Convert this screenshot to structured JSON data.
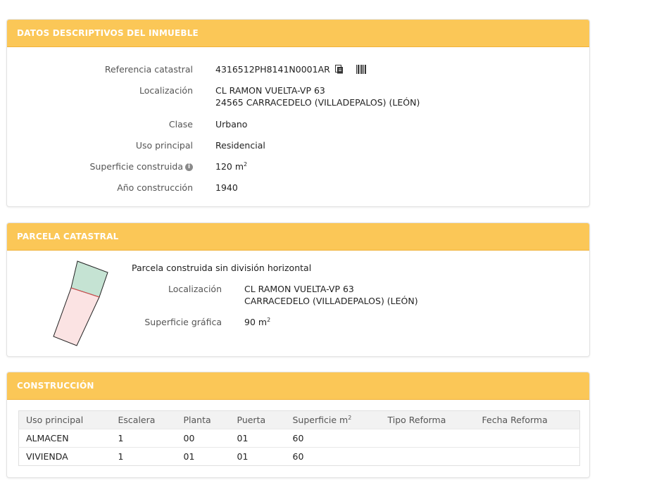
{
  "inmueble": {
    "title": "DATOS DESCRIPTIVOS DEL INMUEBLE",
    "fields": {
      "ref_label": "Referencia catastral",
      "ref_value": "4316512PH8141N0001AR",
      "loc_label": "Localización",
      "loc_line1": "CL RAMON VUELTA-VP 63",
      "loc_line2": "24565 CARRACEDELO (VILLADEPALOS) (LEÓN)",
      "clase_label": "Clase",
      "clase_value": "Urbano",
      "uso_label": "Uso principal",
      "uso_value": "Residencial",
      "sup_label": "Superficie construida",
      "sup_value": "120 m",
      "sup_unit_exp": "2",
      "anio_label": "Año construcción",
      "anio_value": "1940"
    },
    "info_icon": "i"
  },
  "parcela": {
    "title": "PARCELA CATASTRAL",
    "description": "Parcela construida sin división horizontal",
    "loc_label": "Localización",
    "loc_line1": "CL RAMON VUELTA-VP 63",
    "loc_line2": "CARRACEDELO (VILLADEPALOS) (LEÓN)",
    "sup_label": "Superficie gráfica",
    "sup_value": "90 m",
    "sup_unit_exp": "2"
  },
  "construccion": {
    "title": "CONSTRUCCIÓN",
    "headers": [
      "Uso principal",
      "Escalera",
      "Planta",
      "Puerta",
      "Superficie m",
      "Tipo Reforma",
      "Fecha Reforma"
    ],
    "sup_header_exp": "2",
    "rows": [
      [
        "ALMACEN",
        "1",
        "00",
        "01",
        "60",
        "",
        ""
      ],
      [
        "VIVIENDA",
        "1",
        "01",
        "01",
        "60",
        "",
        ""
      ]
    ]
  },
  "colors": {
    "header_bg": "#fbc757",
    "parcel_green": "#c5e3d3",
    "parcel_pink": "#fbe3e3",
    "parcel_divider": "#e05050"
  }
}
